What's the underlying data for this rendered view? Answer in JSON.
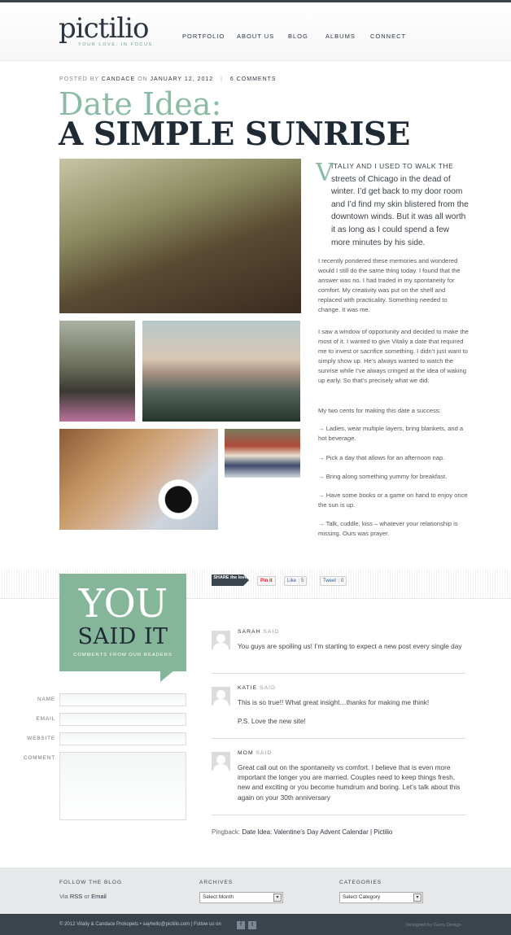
{
  "site": {
    "logo": "pictilio",
    "tagline": "YOUR LOVE. IN FOCUS.",
    "nav": [
      "PORTFOLIO",
      "ABOUT US",
      "BLOG",
      "ALBUMS",
      "CONNECT"
    ]
  },
  "post": {
    "posted_by": "POSTED BY",
    "author": "CANDACE",
    "on": "ON",
    "date": "JANUARY 12, 2012",
    "comments_link": "6 COMMENTS",
    "title_line1": "Date Idea:",
    "title_line2": "A SIMPLE SUNRISE",
    "drop_cap": "V",
    "lead_caps": "ITALIY AND I USED TO WALK THE",
    "lead_rest": "streets of Chicago in the dead of winter. I’d get back to my door room and I’d find my skin blistered from the downtown winds. But it was all worth it as long as I could spend a few more minutes by his side.",
    "p1": "I recently pondered these memories and wondered would I still do the same thing today. I found that the answer was no. I had traded in my spontaneity for comfort. My creativity was put on the shelf and replaced with practicality. Something needed to change. It was me.",
    "p2": "I saw a window of opportunity and decided to make the most of it. I wanted to give Vitaliy a date that required me to invest or sacrifice something. I didn’t just want to simply show up. He’s always wanted to watch the sunrise while I’ve always cringed at the idea of waking up early. So that’s precisely what we did.",
    "p3": "My two cents for making this date a success:",
    "tips": [
      "→ Ladies, wear multiple layers, bring blankets, and a hot beverage.",
      "→ Pick a day that allows for an afternoon nap.",
      "→ Bring along something yummy for breakfast.",
      "→ Have some books or a game on hand to enjoy once the sun is up.",
      "→ Talk, cuddle, kiss – whatever your relationship is missing. Ours was prayer."
    ]
  },
  "share": {
    "share_label": "SHARE the love",
    "pin_label": "Pin it",
    "like_label": "Like",
    "like_count": "5",
    "tweet_label": "Tweet",
    "tweet_count": "0"
  },
  "comments_box": {
    "you": "YOU",
    "said_it": "SAID IT",
    "subtitle": "COMMENTS FROM OUR READERS"
  },
  "form": {
    "name_label": "NAME",
    "email_label": "EMAIL",
    "website_label": "WEBSITE",
    "comment_label": "COMMENT"
  },
  "comments": [
    {
      "name": "SARAH",
      "said": "SAID",
      "text": "You guys are spoiling us! I’m starting to expect a new post every single day"
    },
    {
      "name": "KATIE",
      "said": "SAID",
      "text": "This is so true!! What great insight…thanks for making me think!",
      "text2": "P.S. Love the new site!"
    },
    {
      "name": "MOM",
      "said": "SAID",
      "text": "Great call out on the spontaneity vs comfort. I believe that is even more important the longer you are married. Couples need to keep things fresh, new and exciting or you become humdrum and boring. Let’s talk about this again on your 30th anniversary"
    }
  ],
  "pingback": {
    "label": "Pingback:",
    "link": "Date Idea: Valentine’s Day Advent Calendar | Pictilio"
  },
  "footer": {
    "follow_head": "FOLLOW THE BLOG",
    "via": "Via",
    "rss": "RSS",
    "or": "or",
    "email": "Email",
    "archives_head": "ARCHIVES",
    "archives_select": "Select Month",
    "categories_head": "CATEGORIES",
    "categories_select": "Select Category",
    "copyright": "© 2012 Vitaliy & Candace Prokopets  •  sayhello@pictilio.com  |  Follow us on",
    "facebook_glyph": "f",
    "twitter_glyph": "t",
    "designed": "Designed by Gurry Design"
  }
}
